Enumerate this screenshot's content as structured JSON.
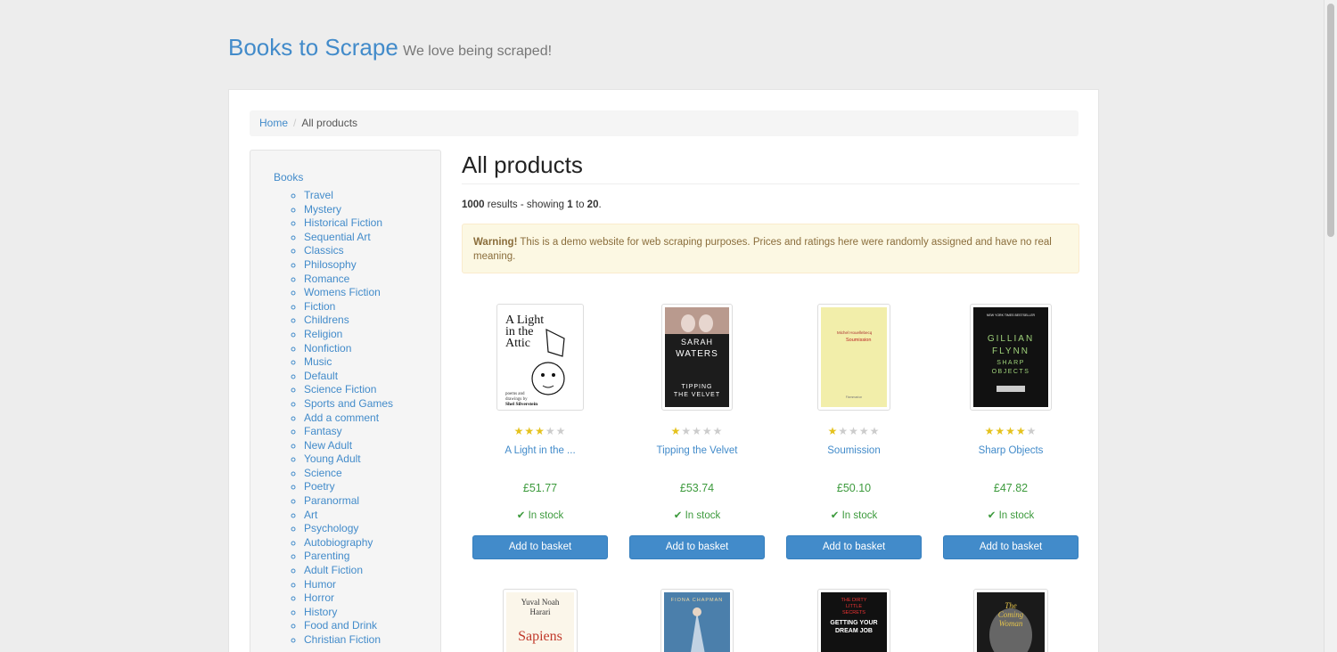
{
  "header": {
    "brand": "Books to Scrape",
    "tagline": "We love being scraped!"
  },
  "breadcrumb": {
    "home": "Home",
    "sep": "/",
    "current": "All products"
  },
  "sidebar": {
    "root": "Books",
    "categories": [
      "Travel",
      "Mystery",
      "Historical Fiction",
      "Sequential Art",
      "Classics",
      "Philosophy",
      "Romance",
      "Womens Fiction",
      "Fiction",
      "Childrens",
      "Religion",
      "Nonfiction",
      "Music",
      "Default",
      "Science Fiction",
      "Sports and Games",
      "Add a comment",
      "Fantasy",
      "New Adult",
      "Young Adult",
      "Science",
      "Poetry",
      "Paranormal",
      "Art",
      "Psychology",
      "Autobiography",
      "Parenting",
      "Adult Fiction",
      "Humor",
      "Horror",
      "History",
      "Food and Drink",
      "Christian Fiction"
    ]
  },
  "main": {
    "heading": "All products",
    "results": {
      "total": "1000",
      "text1": " results - showing ",
      "from": "1",
      "text2": " to ",
      "to": "20",
      "text3": "."
    },
    "warning": {
      "label": "Warning!",
      "text": " This is a demo website for web scraping purposes. Prices and ratings here were randomly assigned and have no real meaning."
    }
  },
  "products": [
    {
      "title": "A Light in the ...",
      "price": "£51.77",
      "stock": "In stock",
      "rating": 3,
      "button": "Add to basket"
    },
    {
      "title": "Tipping the Velvet",
      "price": "£53.74",
      "stock": "In stock",
      "rating": 1,
      "button": "Add to basket"
    },
    {
      "title": "Soumission",
      "price": "£50.10",
      "stock": "In stock",
      "rating": 1,
      "button": "Add to basket"
    },
    {
      "title": "Sharp Objects",
      "price": "£47.82",
      "stock": "In stock",
      "rating": 4,
      "button": "Add to basket"
    }
  ],
  "covers": {
    "c1": {
      "line1": "A Light",
      "line2": "in the",
      "line3": "Attic",
      "foot1": "poems and",
      "foot2": "drawings by",
      "author": "Shel Silverstein"
    },
    "c2": {
      "author1": "SARAH",
      "author2": "WATERS",
      "title1": "TIPPING",
      "title2": "THE VELVET"
    },
    "c3": {
      "author": "Michel Houellebecq",
      "title": "Soumission",
      "publisher": "Flammarion"
    },
    "c4": {
      "top": "NEW YORK TIMES BESTSELLER",
      "author1": "GILLIAN",
      "author2": "FLYNN",
      "title1": "SHARP",
      "title2": "OBJECTS"
    },
    "c5": {
      "author1": "Yuval Noah",
      "author2": "Harari",
      "title": "Sapiens"
    },
    "c6": {
      "author": "FIONA CHAPMAN"
    },
    "c7": {
      "line1": "THE DIRTY",
      "line2": "LITTLE",
      "line3": "SECRETS",
      "line4": "GETTING YOUR",
      "line5": "DREAM JOB"
    },
    "c8": {
      "line1": "The",
      "line2": "Coming",
      "line3": "Woman"
    }
  },
  "colors": {
    "link": "#428bca",
    "price": "#3c9a3c",
    "star": "#e5c21d"
  }
}
